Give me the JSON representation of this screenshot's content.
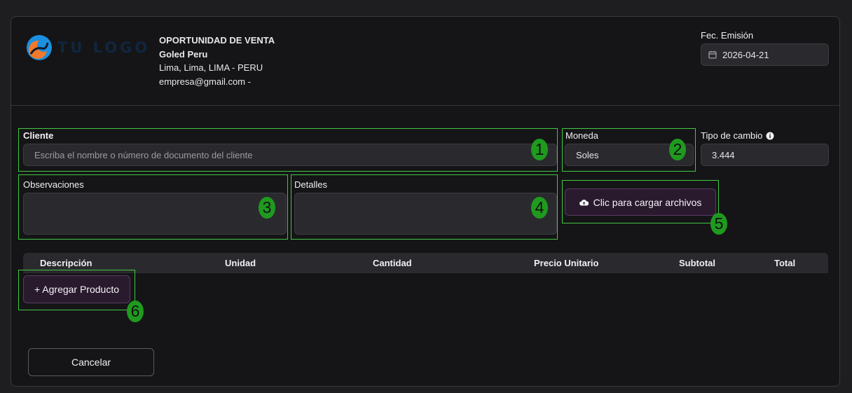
{
  "header": {
    "logo_text": "TU LOGO",
    "title": "OPORTUNIDAD DE VENTA",
    "company_name": "Goled Peru",
    "location": "Lima, Lima, LIMA - PERU",
    "contact": "empresa@gmail.com -"
  },
  "issue_date": {
    "label": "Fec. Emisión",
    "value": "2026-04-21"
  },
  "client": {
    "label": "Cliente",
    "placeholder": "Escriba el nombre o número de documento del cliente"
  },
  "currency": {
    "label": "Moneda",
    "value": "Soles"
  },
  "exchange_rate": {
    "label": "Tipo de cambio",
    "value": "3.444"
  },
  "observations": {
    "label": "Observaciones",
    "value": ""
  },
  "details": {
    "label": "Detalles",
    "value": ""
  },
  "upload": {
    "label": "Clic para cargar archivos"
  },
  "table": {
    "columns": [
      "Descripción",
      "Unidad",
      "Cantidad",
      "Precio Unitario",
      "Subtotal",
      "Total"
    ]
  },
  "add_product": {
    "label": "+ Agregar Producto"
  },
  "cancel": {
    "label": "Cancelar"
  },
  "annotations": [
    "1",
    "2",
    "3",
    "4",
    "5",
    "6"
  ],
  "colors": {
    "background": "#1e1e21",
    "card": "#151517",
    "field": "#2a2a2e",
    "primary_button": "#2a1a2e",
    "annotation_border": "#43c743",
    "annotation_badge": "#1f9a1f"
  }
}
